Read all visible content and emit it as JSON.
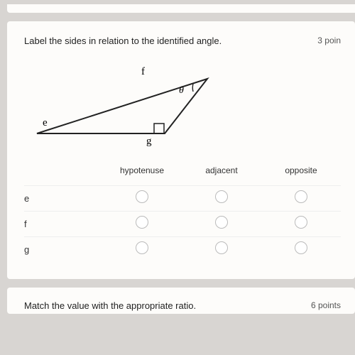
{
  "question1": {
    "prompt": "Label the sides in relation to the identified angle.",
    "points_label": "3 poin",
    "triangle_labels": {
      "f": "f",
      "theta": "θ",
      "e": "e",
      "g": "g"
    },
    "columns": [
      "hypotenuse",
      "adjacent",
      "opposite"
    ],
    "rows": [
      "e",
      "f",
      "g"
    ]
  },
  "question2": {
    "prompt": "Match the value with the appropriate ratio.",
    "points_label": "6 points"
  }
}
